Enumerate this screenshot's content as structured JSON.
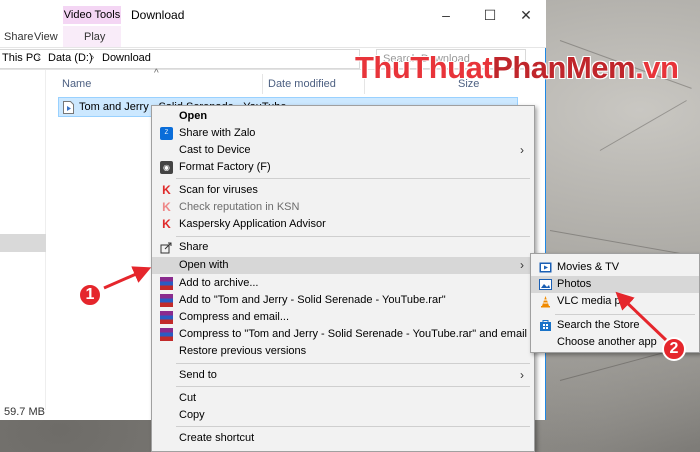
{
  "window": {
    "ribbon_context_tab": "Video Tools",
    "title": "Download",
    "controls": {
      "minimize": "–",
      "maximize": "☐",
      "close": "✕"
    }
  },
  "ribbon": {
    "tabs": [
      "Share",
      "View",
      "Play"
    ]
  },
  "address": {
    "crumbs": [
      "This PC",
      "Data (D:)",
      "Download"
    ],
    "search_placeholder": "Search Download"
  },
  "columns": {
    "name": "Name",
    "date_modified": "Date modified",
    "size": "Size"
  },
  "file": {
    "name": "Tom and Jerry - Solid Serenade - YouTube"
  },
  "status": {
    "size": "59.7 MB"
  },
  "watermark": {
    "part1": "ThuThuat",
    "part2": "PhanMem",
    "part3": ".vn"
  },
  "context_menu": {
    "open": "Open",
    "share_zalo": "Share with Zalo",
    "cast": "Cast to Device",
    "format_factory": "Format Factory (F)",
    "scan_virus": "Scan for viruses",
    "check_reputation": "Check reputation in KSN",
    "kaspersky_advisor": "Kaspersky Application Advisor",
    "share": "Share",
    "open_with": "Open with",
    "add_archive": "Add to archive...",
    "add_rar": "Add to \"Tom and Jerry - Solid Serenade - YouTube.rar\"",
    "compress_email": "Compress and email...",
    "compress_rar_email": "Compress to \"Tom and Jerry - Solid Serenade - YouTube.rar\" and email",
    "restore": "Restore previous versions",
    "send_to": "Send to",
    "cut": "Cut",
    "copy": "Copy",
    "create_shortcut": "Create shortcut"
  },
  "open_with_menu": {
    "movies_tv": "Movies & TV",
    "photos": "Photos",
    "vlc": "VLC media pla",
    "search_store": "Search the Store",
    "choose_app": "Choose another app"
  },
  "annotations": {
    "step1": "1",
    "step2": "2",
    "accent": "#e5262c"
  }
}
